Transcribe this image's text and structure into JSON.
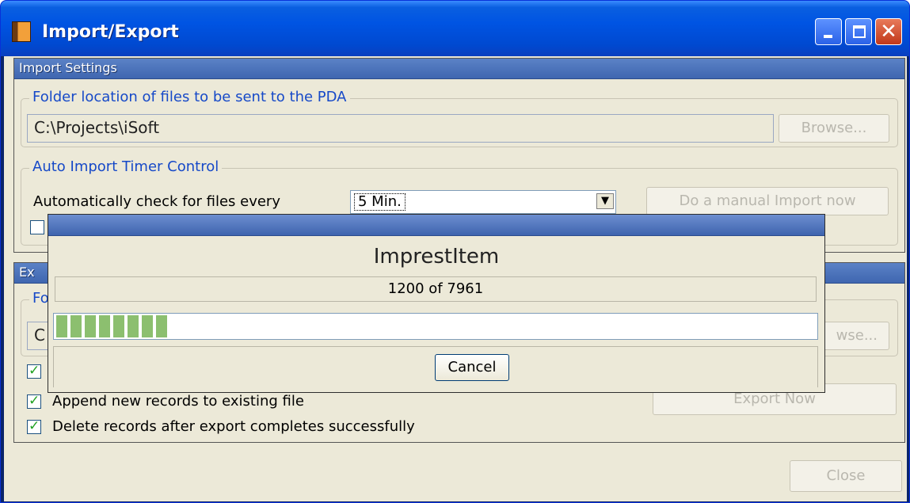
{
  "window": {
    "title": "Import/Export",
    "close_glyph": "✕"
  },
  "import_settings": {
    "header": "Import Settings",
    "folder_group": {
      "legend": "Folder location of files to be sent to the PDA",
      "path": "C:\\Projects\\iSoft",
      "browse_label": "Browse..."
    },
    "timer_group": {
      "legend": "Auto Import Timer Control",
      "check_label": "Automatically check for files every",
      "interval": "5 Min.",
      "manual_import_label": "Do a manual Import now"
    }
  },
  "export_settings": {
    "header_partial": "Ex",
    "folder_legend_partial": "Fo",
    "path_partial": "C",
    "browse_partial": "wse...",
    "append_label": "Append new records to existing file",
    "delete_label": "Delete records after export completes successfully",
    "export_now_label": "Export Now"
  },
  "footer": {
    "close_label": "Close"
  },
  "progress_dialog": {
    "heading": "ImprestItem",
    "count_text": "1200 of 7961",
    "current": 1200,
    "total": 7961,
    "cancel_label": "Cancel"
  }
}
